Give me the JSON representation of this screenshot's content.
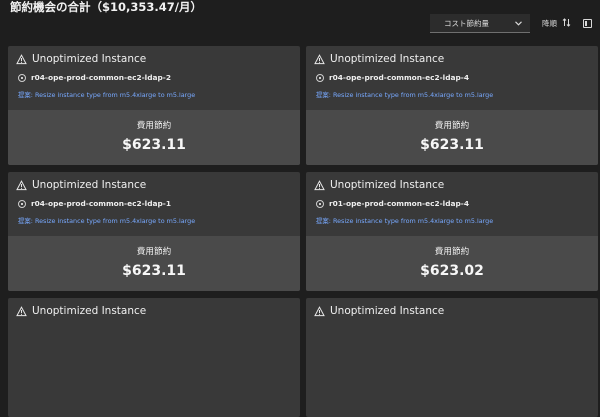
{
  "header": {
    "title": "節約機会の合計（$10,353.47/月）",
    "sort_select_value": "コスト節約量",
    "sort_label": "降順",
    "sort_icon": "sort-arrows-icon",
    "panel_icon": "panel-toggle-icon"
  },
  "cards": [
    {
      "title": "Unoptimized Instance",
      "instance_name": "r04-ope-prod-common-ec2-ldap-2",
      "recommendation": "提案: Resize instance type from m5.4xlarge to m5.large",
      "saving_label": "費用節約",
      "saving_value": "$623.11"
    },
    {
      "title": "Unoptimized Instance",
      "instance_name": "r04-ope-prod-common-ec2-ldap-4",
      "recommendation": "提案: Resize instance type from m5.4xlarge to m5.large",
      "saving_label": "費用節約",
      "saving_value": "$623.11"
    },
    {
      "title": "Unoptimized Instance",
      "instance_name": "r04-ope-prod-common-ec2-ldap-1",
      "recommendation": "提案: Resize instance type from m5.4xlarge to m5.large",
      "saving_label": "費用節約",
      "saving_value": "$623.11"
    },
    {
      "title": "Unoptimized Instance",
      "instance_name": "r01-ope-prod-common-ec2-ldap-4",
      "recommendation": "提案: Resize instance type from m5.4xlarge to m5.large",
      "saving_label": "費用節約",
      "saving_value": "$623.02"
    },
    {
      "title": "Unoptimized Instance"
    },
    {
      "title": "Unoptimized Instance"
    }
  ]
}
